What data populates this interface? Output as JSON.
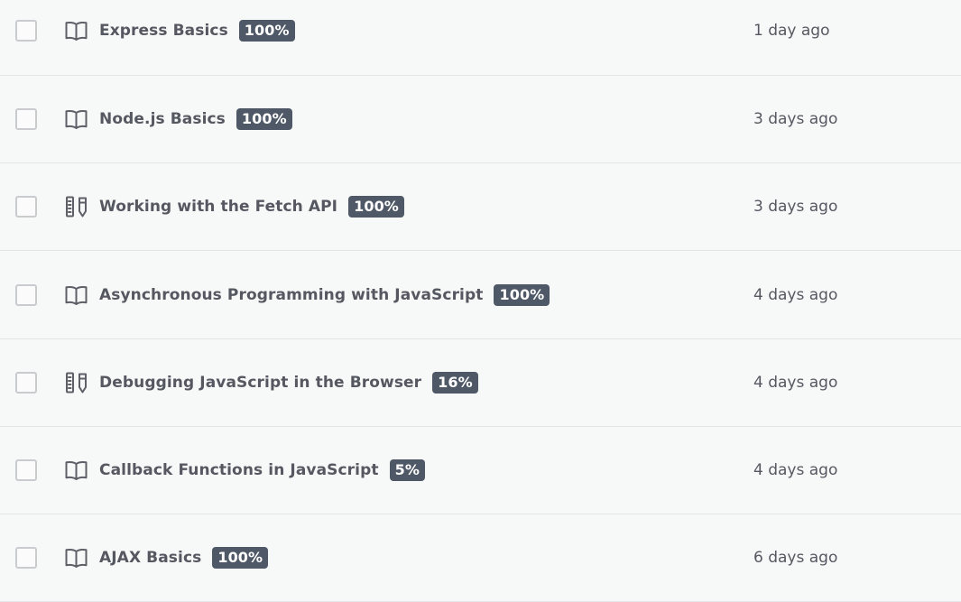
{
  "items": [
    {
      "title": "Express Basics",
      "progress": "100%",
      "time": "1 day ago",
      "type_icon": "book-icon"
    },
    {
      "title": "Node.js Basics",
      "progress": "100%",
      "time": "3 days ago",
      "type_icon": "book-icon"
    },
    {
      "title": "Working with the Fetch API",
      "progress": "100%",
      "time": "3 days ago",
      "type_icon": "tools-icon"
    },
    {
      "title": "Asynchronous Programming with JavaScript",
      "progress": "100%",
      "time": "4 days ago",
      "type_icon": "book-icon"
    },
    {
      "title": "Debugging JavaScript in the Browser",
      "progress": "16%",
      "time": "4 days ago",
      "type_icon": "tools-icon"
    },
    {
      "title": "Callback Functions in JavaScript",
      "progress": "5%",
      "time": "4 days ago",
      "type_icon": "book-icon"
    },
    {
      "title": "AJAX Basics",
      "progress": "100%",
      "time": "6 days ago",
      "type_icon": "book-icon"
    }
  ],
  "colors": {
    "background": "#f7f8f8",
    "badge": "#4e5866",
    "text": "#555860",
    "divider": "#e3e5e6"
  }
}
